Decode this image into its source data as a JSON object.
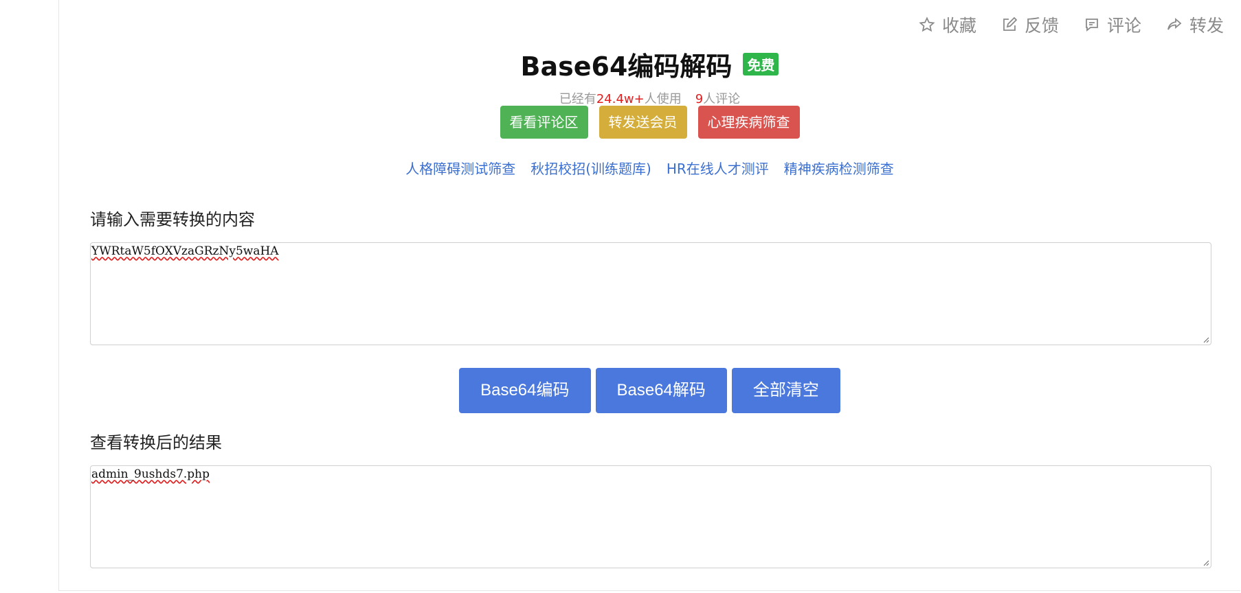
{
  "top_actions": {
    "favorite": "收藏",
    "feedback": "反馈",
    "comment": "评论",
    "share": "转发"
  },
  "header": {
    "title": "Base64编码解码",
    "badge": "免费"
  },
  "stats": {
    "prefix": "已经有",
    "users": "24.4w+",
    "users_suffix": "人使用",
    "comments": "9",
    "comments_suffix": "人评论"
  },
  "quick_buttons": {
    "view_comments": "看看评论区",
    "share_member": "转发送会员",
    "mental_screen": "心理疾病筛查"
  },
  "links": [
    "人格障碍测试筛查",
    "秋招校招(训练题库)",
    "HR在线人才测评",
    "精神疾病检测筛查"
  ],
  "input_section": {
    "label": "请输入需要转换的内容",
    "value": "YWRtaW5fOXVzaGRzNy5waHA"
  },
  "actions": {
    "encode": "Base64编码",
    "decode": "Base64解码",
    "clear": "全部清空"
  },
  "output_section": {
    "label": "查看转换后的结果",
    "value": "admin_9ushds7.php"
  },
  "colors": {
    "primary_button": "#4a78dc",
    "badge_green": "#2fb64a",
    "link_blue": "#3a6fd0",
    "highlight_red": "#e02020"
  }
}
